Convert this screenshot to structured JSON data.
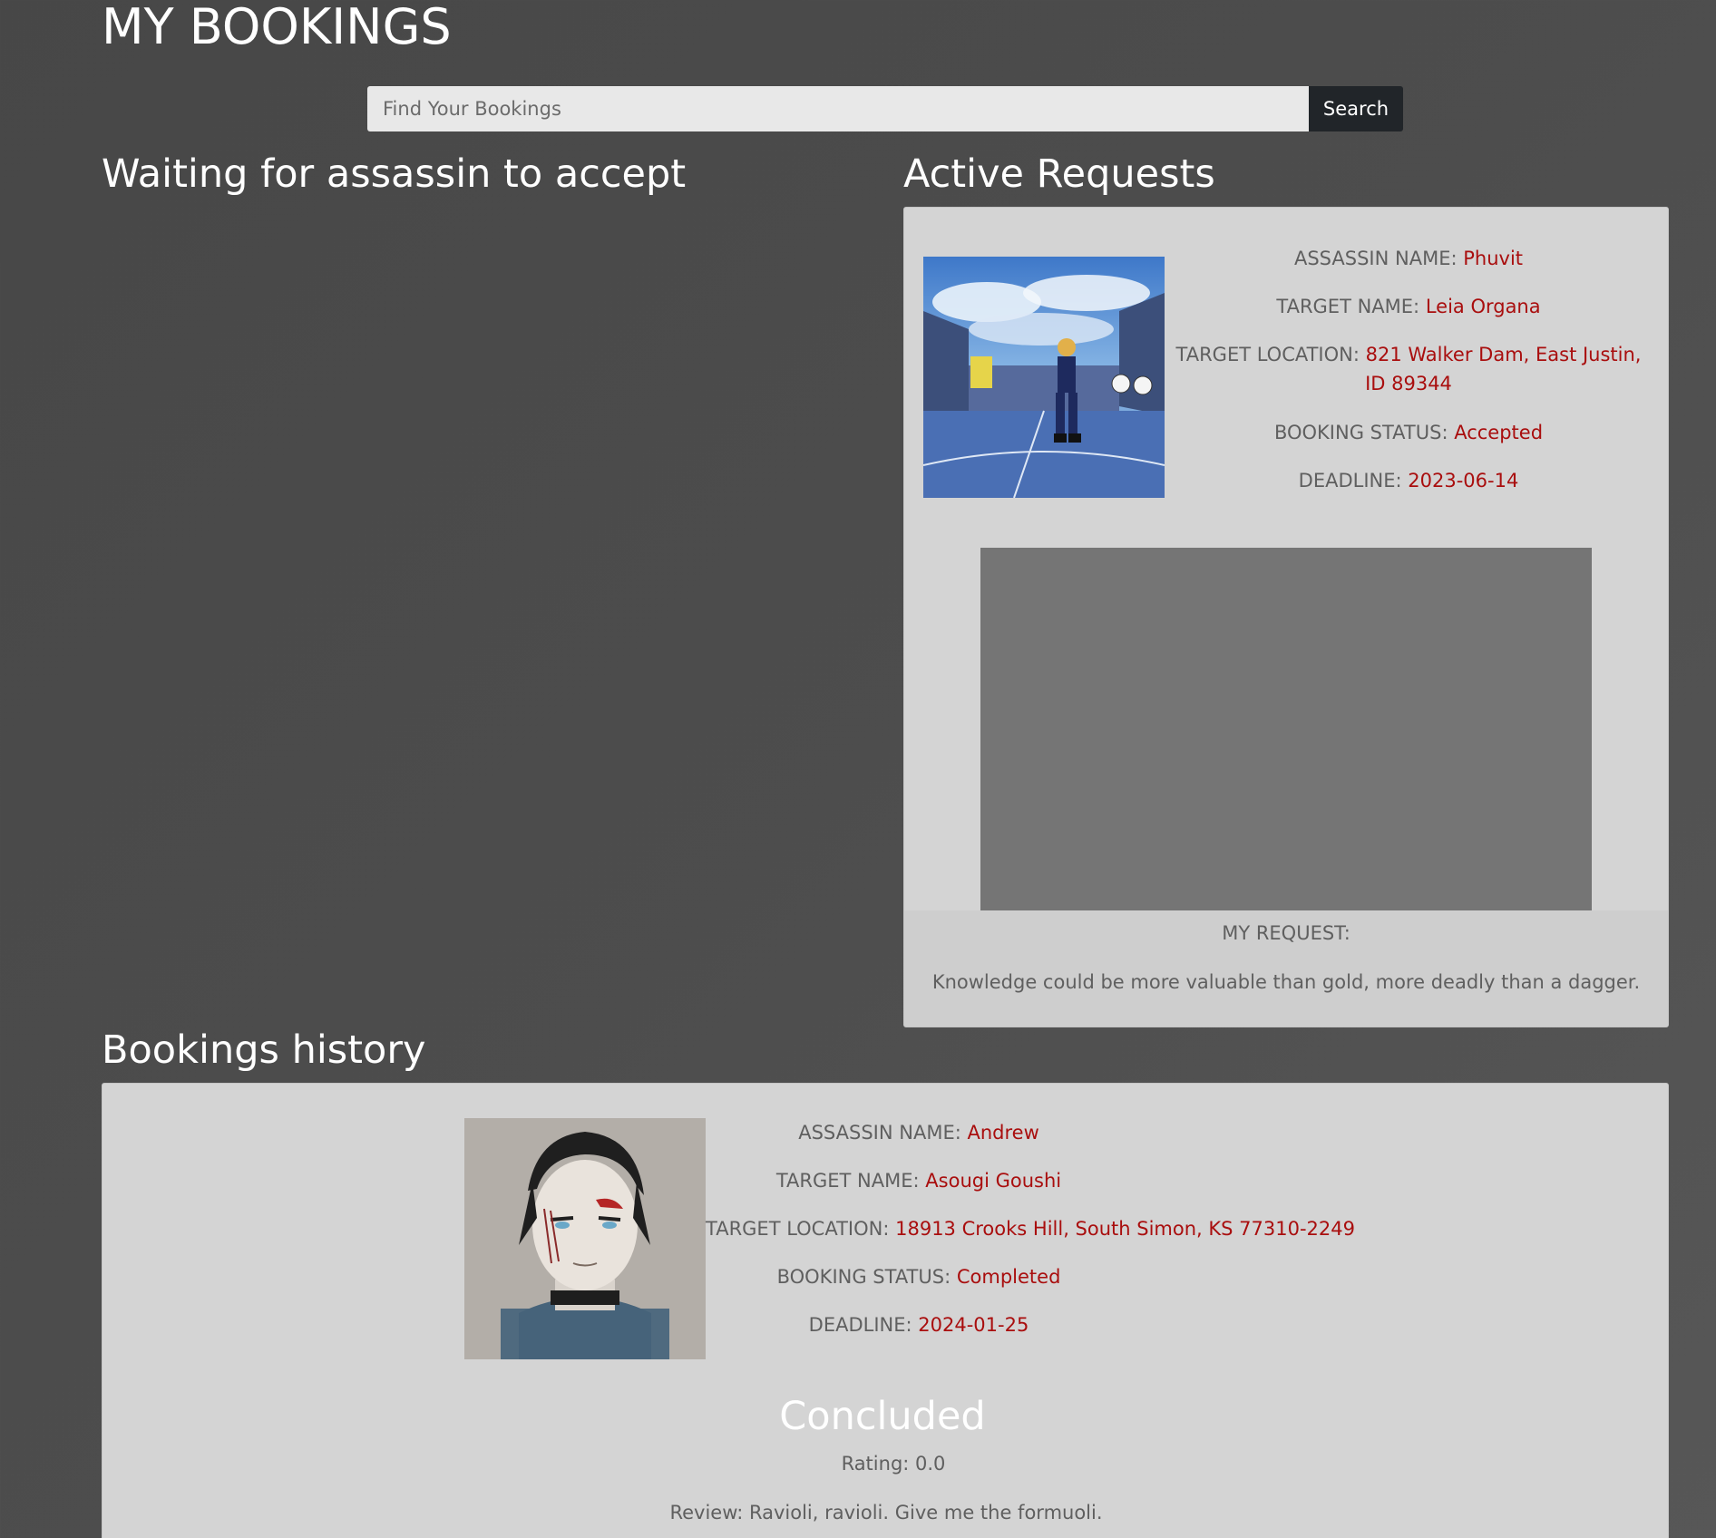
{
  "page": {
    "title": "MY BOOKINGS"
  },
  "search": {
    "placeholder": "Find Your Bookings",
    "value": "",
    "button_label": "Search"
  },
  "sections": {
    "waiting_title": "Waiting for assassin to accept",
    "active_title": "Active Requests",
    "history_title": "Bookings history"
  },
  "labels": {
    "assassin_name": "ASSASSIN NAME:",
    "target_name": "TARGET NAME:",
    "target_location": "TARGET LOCATION:",
    "booking_status": "BOOKING STATUS:",
    "deadline": "DEADLINE:",
    "my_request": "MY REQUEST:"
  },
  "active_request": {
    "assassin_name": "Phuvit",
    "target_name": "Leia Organa",
    "target_location": "821 Walker Dam, East Justin, ID 89344",
    "booking_status": "Accepted",
    "deadline": "2023-06-14",
    "request_text": "Knowledge could be more valuable than gold, more deadly than a dagger.",
    "image_icon": "anime-soccer-player-image"
  },
  "history": {
    "assassin_name": "Andrew",
    "target_name": "Asougi Goushi",
    "target_location": "18913 Crooks Hill, South Simon, KS 77310-2249",
    "booking_status": "Completed",
    "deadline": "2024-01-25",
    "concluded_title": "Concluded",
    "rating": "Rating: 0.0",
    "review": "Review: Ravioli, ravioli. Give me the formuoli.",
    "image_icon": "anime-portrait-image"
  },
  "colors": {
    "background": "#4d4d4d",
    "card": "#d4d4d4",
    "accent_value": "#a90e0e",
    "label_text": "#5f5f5f",
    "search_button": "#212529"
  }
}
